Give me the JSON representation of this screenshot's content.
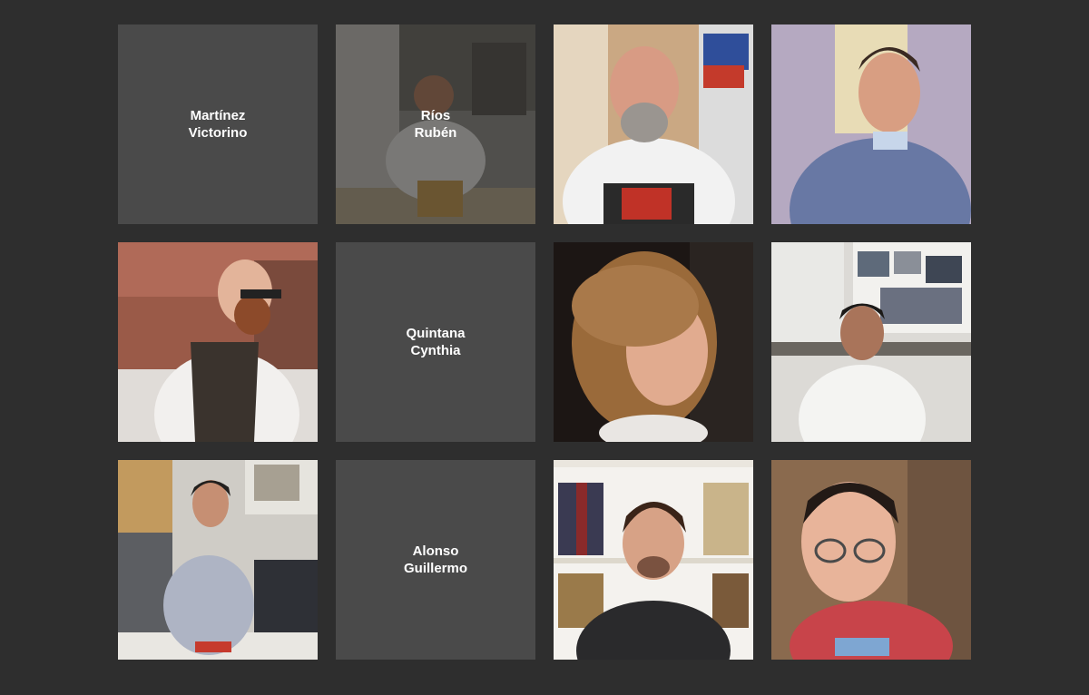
{
  "people": [
    {
      "surname": "Martínez",
      "given": "Victorino",
      "photo": false
    },
    {
      "surname": "Ríos",
      "given": "Rubén",
      "photo": true
    },
    {
      "surname": "",
      "given": "",
      "photo": true
    },
    {
      "surname": "",
      "given": "",
      "photo": true
    },
    {
      "surname": "",
      "given": "",
      "photo": true
    },
    {
      "surname": "Quintana",
      "given": "Cynthia",
      "photo": false
    },
    {
      "surname": "",
      "given": "",
      "photo": true
    },
    {
      "surname": "",
      "given": "",
      "photo": true
    },
    {
      "surname": "",
      "given": "",
      "photo": true
    },
    {
      "surname": "Alonso",
      "given": "Guillermo",
      "photo": false
    },
    {
      "surname": "",
      "given": "",
      "photo": true
    },
    {
      "surname": "",
      "given": "",
      "photo": true
    }
  ],
  "colors": {
    "page_background": "#2e2e2e",
    "placeholder_tile": "#4a4a4a",
    "caption_text": "#ffffff"
  }
}
